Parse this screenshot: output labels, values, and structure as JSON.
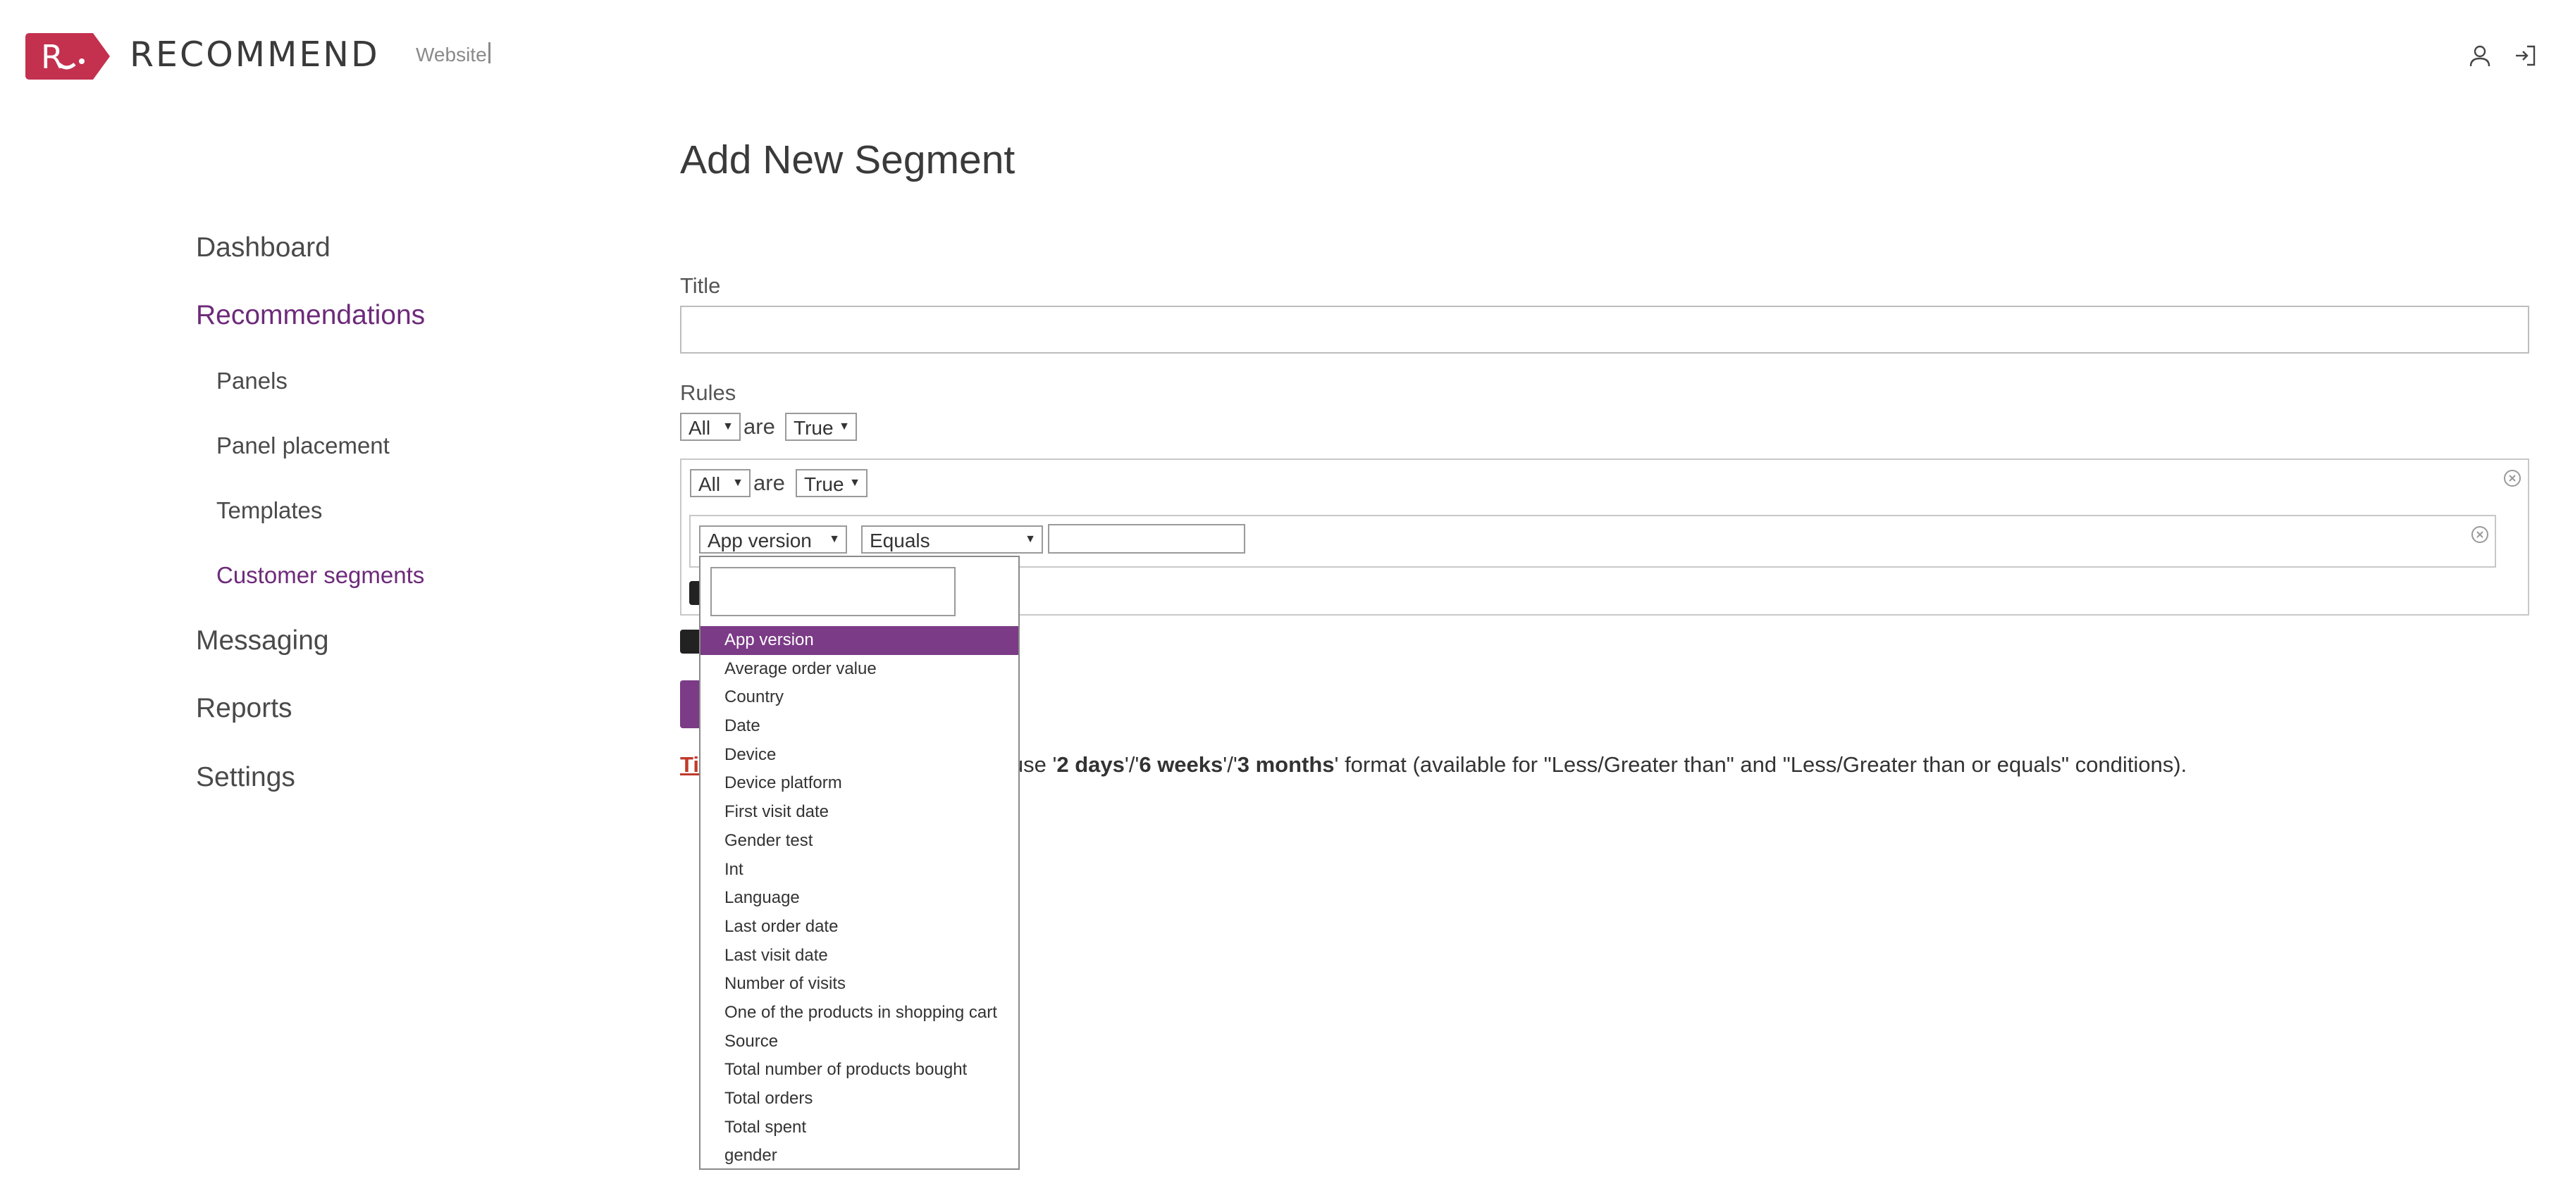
{
  "header": {
    "logo_letter": "R",
    "logo_text": "RECOMMEND",
    "site_label": "Website",
    "brand_color": "#c3314f",
    "icons": [
      "user-icon",
      "logout-icon"
    ]
  },
  "sidebar": {
    "dashboard": "Dashboard",
    "recommendations": "Recommendations",
    "panels": "Panels",
    "panel_placement": "Panel placement",
    "templates": "Templates",
    "customer_segments": "Customer segments",
    "messaging": "Messaging",
    "reports": "Reports",
    "settings": "Settings",
    "active_color": "#6d2a7a"
  },
  "main": {
    "page_title": "Add New Segment",
    "title_label": "Title",
    "title_value": "",
    "rules_label": "Rules",
    "rules_quantifier": "All",
    "are_text": "are",
    "rules_truth": "True",
    "group": {
      "quantifier": "All",
      "are_text": "are",
      "truth": "True",
      "condition": {
        "field": "App version",
        "operator": "Equals",
        "value": ""
      }
    },
    "tip": {
      "prefix": "Ti",
      "text_a": "n use '",
      "bold_1": "2 days",
      "sep_1": "'/'",
      "bold_2": "6 weeks",
      "sep_2": "'/'",
      "bold_3": "3 months",
      "text_b": "' format (available for \"Less/Greater than\" and \"Less/Greater than or equals\" conditions)."
    },
    "accent_color": "#7b3b86"
  },
  "dropdown": {
    "search_value": "",
    "selected": "App version",
    "options": [
      "App version",
      "Average order value",
      "Country",
      "Date",
      "Device",
      "Device platform",
      "First visit date",
      "Gender test",
      "Int",
      "Language",
      "Last order date",
      "Last visit date",
      "Number of visits",
      "One of the products in shopping cart",
      "Source",
      "Total number of products bought",
      "Total orders",
      "Total spent",
      "gender"
    ]
  }
}
